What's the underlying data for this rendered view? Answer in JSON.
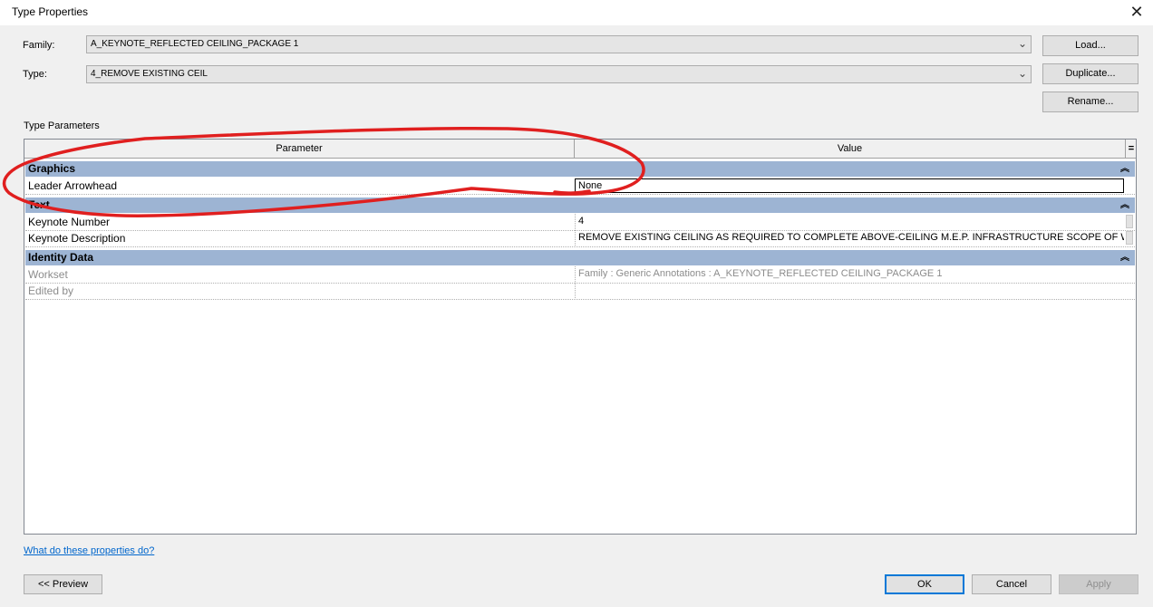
{
  "window": {
    "title": "Type Properties"
  },
  "family": {
    "label": "Family:",
    "value": "A_KEYNOTE_REFLECTED CEILING_PACKAGE 1"
  },
  "type": {
    "label": "Type:",
    "value": "4_REMOVE EXISTING CEIL"
  },
  "buttons": {
    "load": "Load...",
    "duplicate": "Duplicate...",
    "rename": "Rename..."
  },
  "type_parameters": {
    "label": "Type Parameters",
    "headers": {
      "parameter": "Parameter",
      "value": "Value",
      "eq": "="
    },
    "groups": [
      {
        "name": "Graphics",
        "rows": [
          {
            "param": "Leader Arrowhead",
            "value": "None"
          }
        ]
      },
      {
        "name": "Text",
        "rows": [
          {
            "param": "Keynote Number",
            "value": "4"
          },
          {
            "param": "Keynote Description",
            "value": "REMOVE EXISTING CEILING AS REQUIRED TO COMPLETE ABOVE-CEILING M.E.P. INFRASTRUCTURE SCOPE OF WO"
          }
        ]
      },
      {
        "name": "Identity Data",
        "rows": [
          {
            "param": "Workset",
            "value": "Family  : Generic Annotations : A_KEYNOTE_REFLECTED CEILING_PACKAGE 1"
          },
          {
            "param": "Edited by",
            "value": ""
          }
        ]
      }
    ]
  },
  "help_link": "What do these properties do?",
  "footer": {
    "preview": "<< Preview",
    "ok": "OK",
    "cancel": "Cancel",
    "apply": "Apply"
  },
  "icons": {
    "close": "close-icon",
    "dropdown": "chevron-down-icon",
    "collapse": "double-chevron-up-icon"
  },
  "colors": {
    "group_header": "#9db4d3",
    "annotation": "#e01f1f",
    "link": "#0066cc"
  }
}
